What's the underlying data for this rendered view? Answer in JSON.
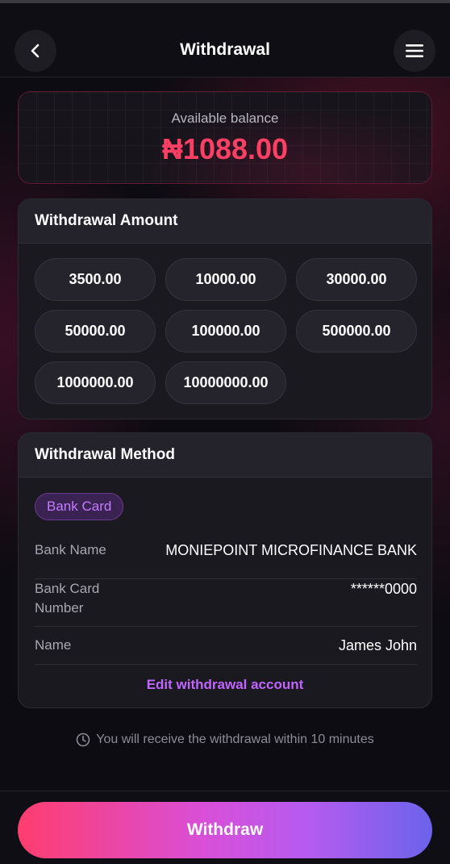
{
  "header": {
    "title": "Withdrawal",
    "back_icon": "chevron-left-icon",
    "menu_icon": "hamburger-menu-icon"
  },
  "balance": {
    "label": "Available balance",
    "value": "₦1088.00"
  },
  "amount_section": {
    "title": "Withdrawal Amount",
    "options": [
      "3500.00",
      "10000.00",
      "30000.00",
      "50000.00",
      "100000.00",
      "500000.00",
      "1000000.00",
      "10000000.00"
    ]
  },
  "method_section": {
    "title": "Withdrawal Method",
    "tag": "Bank Card",
    "rows": [
      {
        "label": "Bank Name",
        "value": "MONIEPOINT MICROFINANCE BANK"
      },
      {
        "label": "Bank Card Number",
        "value": "******0000"
      },
      {
        "label": "Name",
        "value": "James John"
      }
    ],
    "edit_link": "Edit withdrawal account"
  },
  "note": {
    "icon": "clock-icon",
    "text": "You will receive the withdrawal within 10 minutes"
  },
  "footer": {
    "withdraw_label": "Withdraw"
  },
  "colors": {
    "accent_red": "#ff3f64",
    "accent_purple": "#c065ff",
    "background": "#0d0c12"
  }
}
